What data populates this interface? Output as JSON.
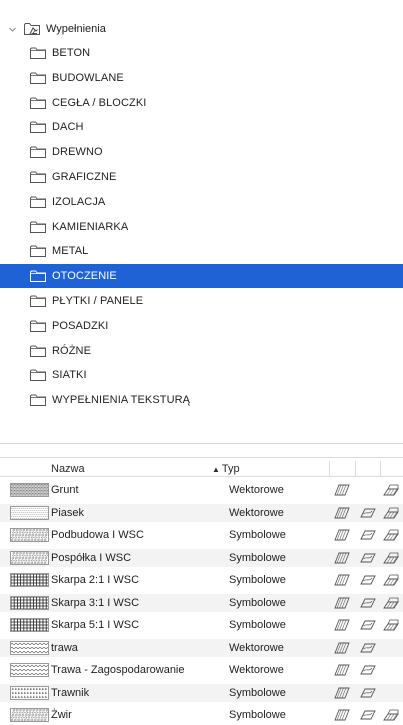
{
  "tree": {
    "root": {
      "label": "Wypełnienia",
      "expanded": true
    },
    "items": [
      {
        "label": "BETON",
        "selected": false
      },
      {
        "label": "BUDOWLANE",
        "selected": false
      },
      {
        "label": "CEGŁA / BLOCZKI",
        "selected": false
      },
      {
        "label": "DACH",
        "selected": false
      },
      {
        "label": "DREWNO",
        "selected": false
      },
      {
        "label": "GRAFICZNE",
        "selected": false
      },
      {
        "label": "IZOLACJA",
        "selected": false
      },
      {
        "label": "KAMIENIARKA",
        "selected": false
      },
      {
        "label": "METAL",
        "selected": false
      },
      {
        "label": "OTOCZENIE",
        "selected": true
      },
      {
        "label": "PŁYTKI / PANELE",
        "selected": false
      },
      {
        "label": "POSADZKI",
        "selected": false
      },
      {
        "label": "RÓŻNE",
        "selected": false
      },
      {
        "label": "SIATKI",
        "selected": false
      },
      {
        "label": "WYPEŁNIENIA TEKSTURĄ",
        "selected": false
      }
    ]
  },
  "table": {
    "columns": {
      "name": "Nazwa",
      "type": "Typ",
      "sort_indicator": "▲"
    },
    "rows": [
      {
        "name": "Grunt",
        "type": "Wektorowe",
        "pattern": "dense-dots",
        "icons": [
          "draft-icon",
          "",
          "section-icon"
        ]
      },
      {
        "name": "Piasek",
        "type": "Wektorowe",
        "pattern": "sparse-dots",
        "icons": [
          "draft-icon",
          "cover-icon",
          "section-icon"
        ]
      },
      {
        "name": "Podbudowa I WSC",
        "type": "Symbolowe",
        "pattern": "gravel",
        "icons": [
          "draft-icon",
          "cover-icon",
          "section-icon"
        ]
      },
      {
        "name": "Pospółka I WSC",
        "type": "Symbolowe",
        "pattern": "gravel",
        "icons": [
          "draft-icon",
          "cover-icon",
          "section-icon"
        ]
      },
      {
        "name": "Skarpa 2:1 I WSC",
        "type": "Symbolowe",
        "pattern": "grid",
        "icons": [
          "draft-icon",
          "cover-icon",
          "section-icon"
        ]
      },
      {
        "name": "Skarpa 3:1 I WSC",
        "type": "Symbolowe",
        "pattern": "grid",
        "icons": [
          "draft-icon",
          "cover-icon",
          "section-icon"
        ]
      },
      {
        "name": "Skarpa 5:1 I WSC",
        "type": "Symbolowe",
        "pattern": "grid",
        "icons": [
          "draft-icon",
          "cover-icon",
          "section-icon"
        ]
      },
      {
        "name": "trawa",
        "type": "Wektorowe",
        "pattern": "wave",
        "icons": [
          "draft-icon",
          "cover-icon",
          ""
        ]
      },
      {
        "name": "Trawa - Zagospodarowanie",
        "type": "Wektorowe",
        "pattern": "wave",
        "icons": [
          "draft-icon",
          "cover-icon",
          ""
        ]
      },
      {
        "name": "Trawnik",
        "type": "Symbolowe",
        "pattern": "grass",
        "icons": [
          "draft-icon",
          "cover-icon",
          ""
        ]
      },
      {
        "name": "Żwir",
        "type": "Symbolowe",
        "pattern": "gravel",
        "icons": [
          "draft-icon",
          "cover-icon",
          "section-icon"
        ]
      }
    ]
  },
  "colors": {
    "selection": "#1f62d6",
    "alt_row": "#f3f3f3"
  }
}
